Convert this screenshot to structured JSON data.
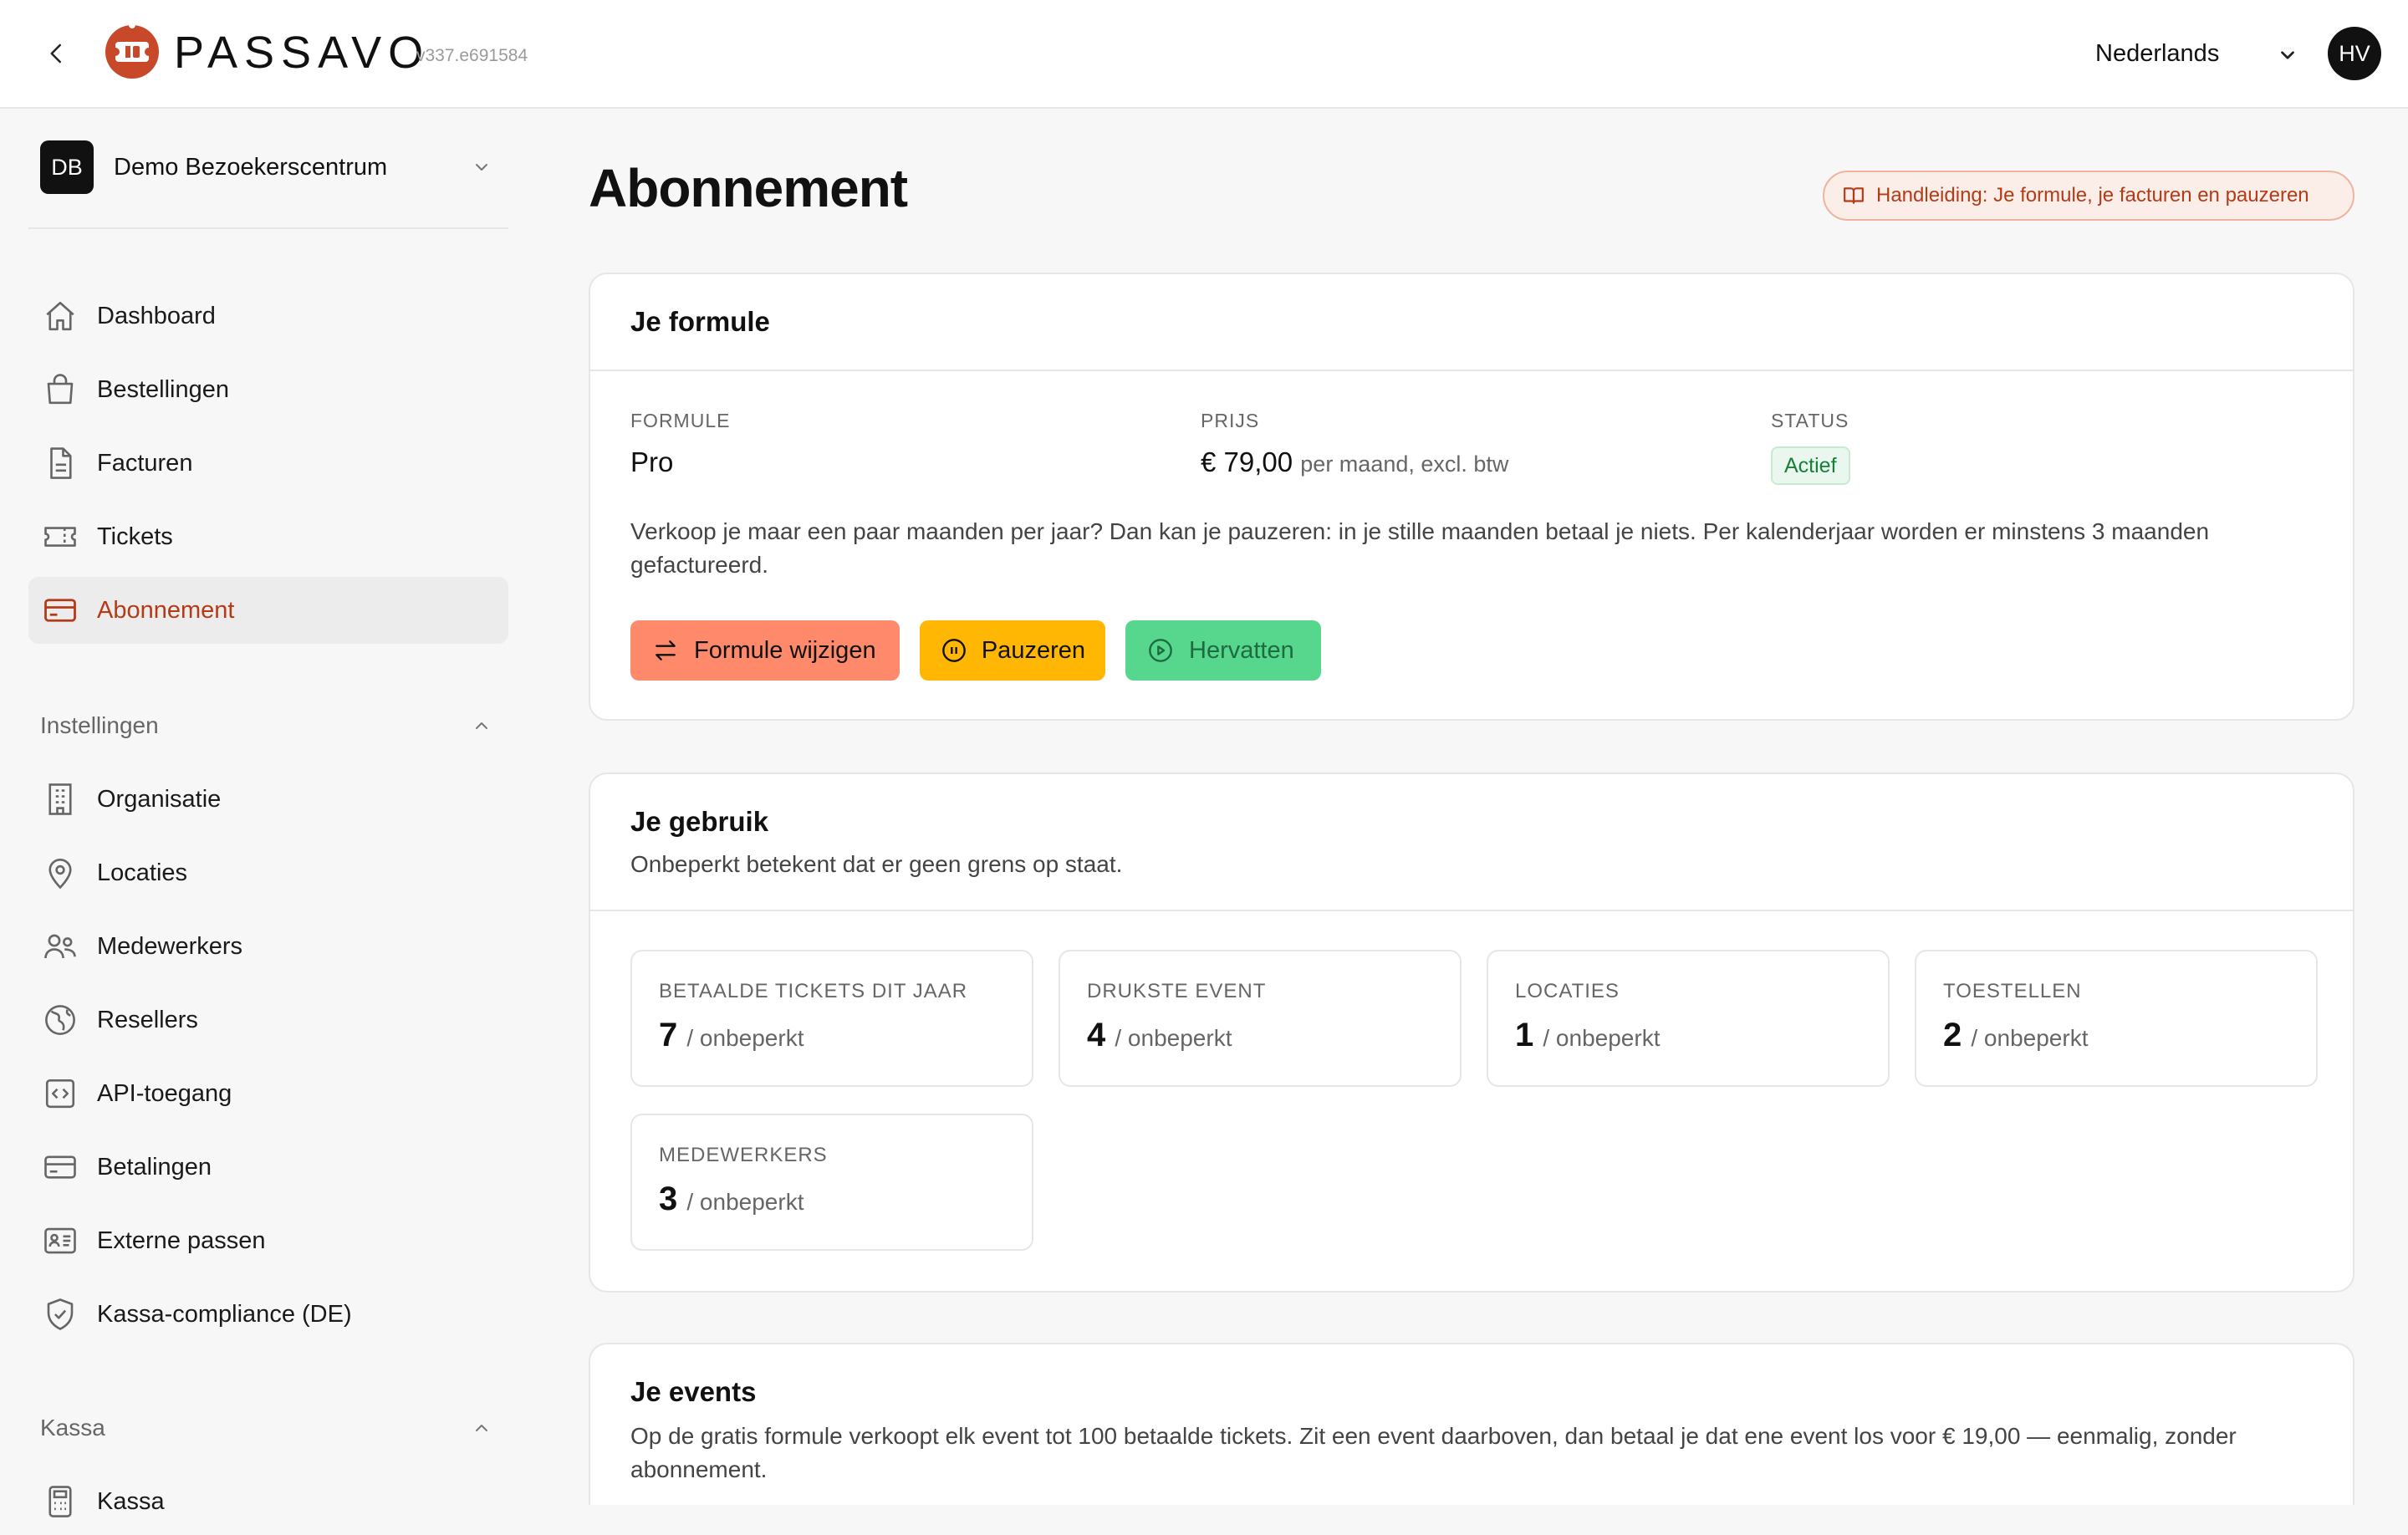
{
  "header": {
    "brand": "PASSAVO",
    "version": "v337.e691584",
    "language": "Nederlands",
    "avatar_initials": "HV"
  },
  "sidebar": {
    "org_initials": "DB",
    "org_name": "Demo Bezoekerscentrum",
    "main_items": [
      {
        "label": "Dashboard",
        "icon": "home-icon"
      },
      {
        "label": "Bestellingen",
        "icon": "shopping-bag-icon"
      },
      {
        "label": "Facturen",
        "icon": "document-icon"
      },
      {
        "label": "Tickets",
        "icon": "ticket-icon"
      },
      {
        "label": "Abonnement",
        "icon": "credit-card-icon",
        "active": true
      }
    ],
    "settings_heading": "Instellingen",
    "settings_items": [
      {
        "label": "Organisatie",
        "icon": "building-icon"
      },
      {
        "label": "Locaties",
        "icon": "map-pin-icon"
      },
      {
        "label": "Medewerkers",
        "icon": "users-icon"
      },
      {
        "label": "Resellers",
        "icon": "globe-icon"
      },
      {
        "label": "API-toegang",
        "icon": "code-icon"
      },
      {
        "label": "Betalingen",
        "icon": "credit-card-icon"
      },
      {
        "label": "Externe passen",
        "icon": "id-card-icon"
      },
      {
        "label": "Kassa-compliance (DE)",
        "icon": "shield-check-icon"
      }
    ],
    "kassa_heading": "Kassa",
    "kassa_items": [
      {
        "label": "Kassa",
        "icon": "calculator-icon"
      }
    ]
  },
  "main": {
    "title": "Abonnement",
    "guide_label": "Handleiding: Je formule, je facturen en pauzeren",
    "formula_card": {
      "title": "Je formule",
      "formula_label": "FORMULE",
      "formula_value": "Pro",
      "price_label": "PRIJS",
      "price_value": "€ 79,00",
      "price_suffix": "per maand, excl. btw",
      "status_label": "STATUS",
      "status_value": "Actief",
      "description": "Verkoop je maar een paar maanden per jaar? Dan kan je pauzeren: in je stille maanden betaal je niets. Per kalenderjaar worden er minstens 3 maanden gefactureerd.",
      "buttons": {
        "change": "Formule wijzigen",
        "pause": "Pauzeren",
        "resume": "Hervatten"
      }
    },
    "usage_card": {
      "title": "Je gebruik",
      "subtitle": "Onbeperkt betekent dat er geen grens op staat.",
      "items": [
        {
          "label": "BETAALDE TICKETS DIT JAAR",
          "value": "7",
          "limit": "/ onbeperkt"
        },
        {
          "label": "DRUKSTE EVENT",
          "value": "4",
          "limit": "/ onbeperkt"
        },
        {
          "label": "LOCATIES",
          "value": "1",
          "limit": "/ onbeperkt"
        },
        {
          "label": "TOESTELLEN",
          "value": "2",
          "limit": "/ onbeperkt"
        },
        {
          "label": "MEDEWERKERS",
          "value": "3",
          "limit": "/ onbeperkt"
        }
      ]
    },
    "events_card": {
      "title": "Je events",
      "description": "Op de gratis formule verkoopt elk event tot 100 betaalde tickets. Zit een event daarboven, dan betaal je dat ene event los voor € 19,00 — eenmalig, zonder abonnement."
    }
  },
  "colors": {
    "accent": "#b63a16",
    "btn_change": "#ff8a6b",
    "btn_pause": "#ffb703",
    "btn_resume": "#57d68d",
    "status_green": "#16813a"
  }
}
